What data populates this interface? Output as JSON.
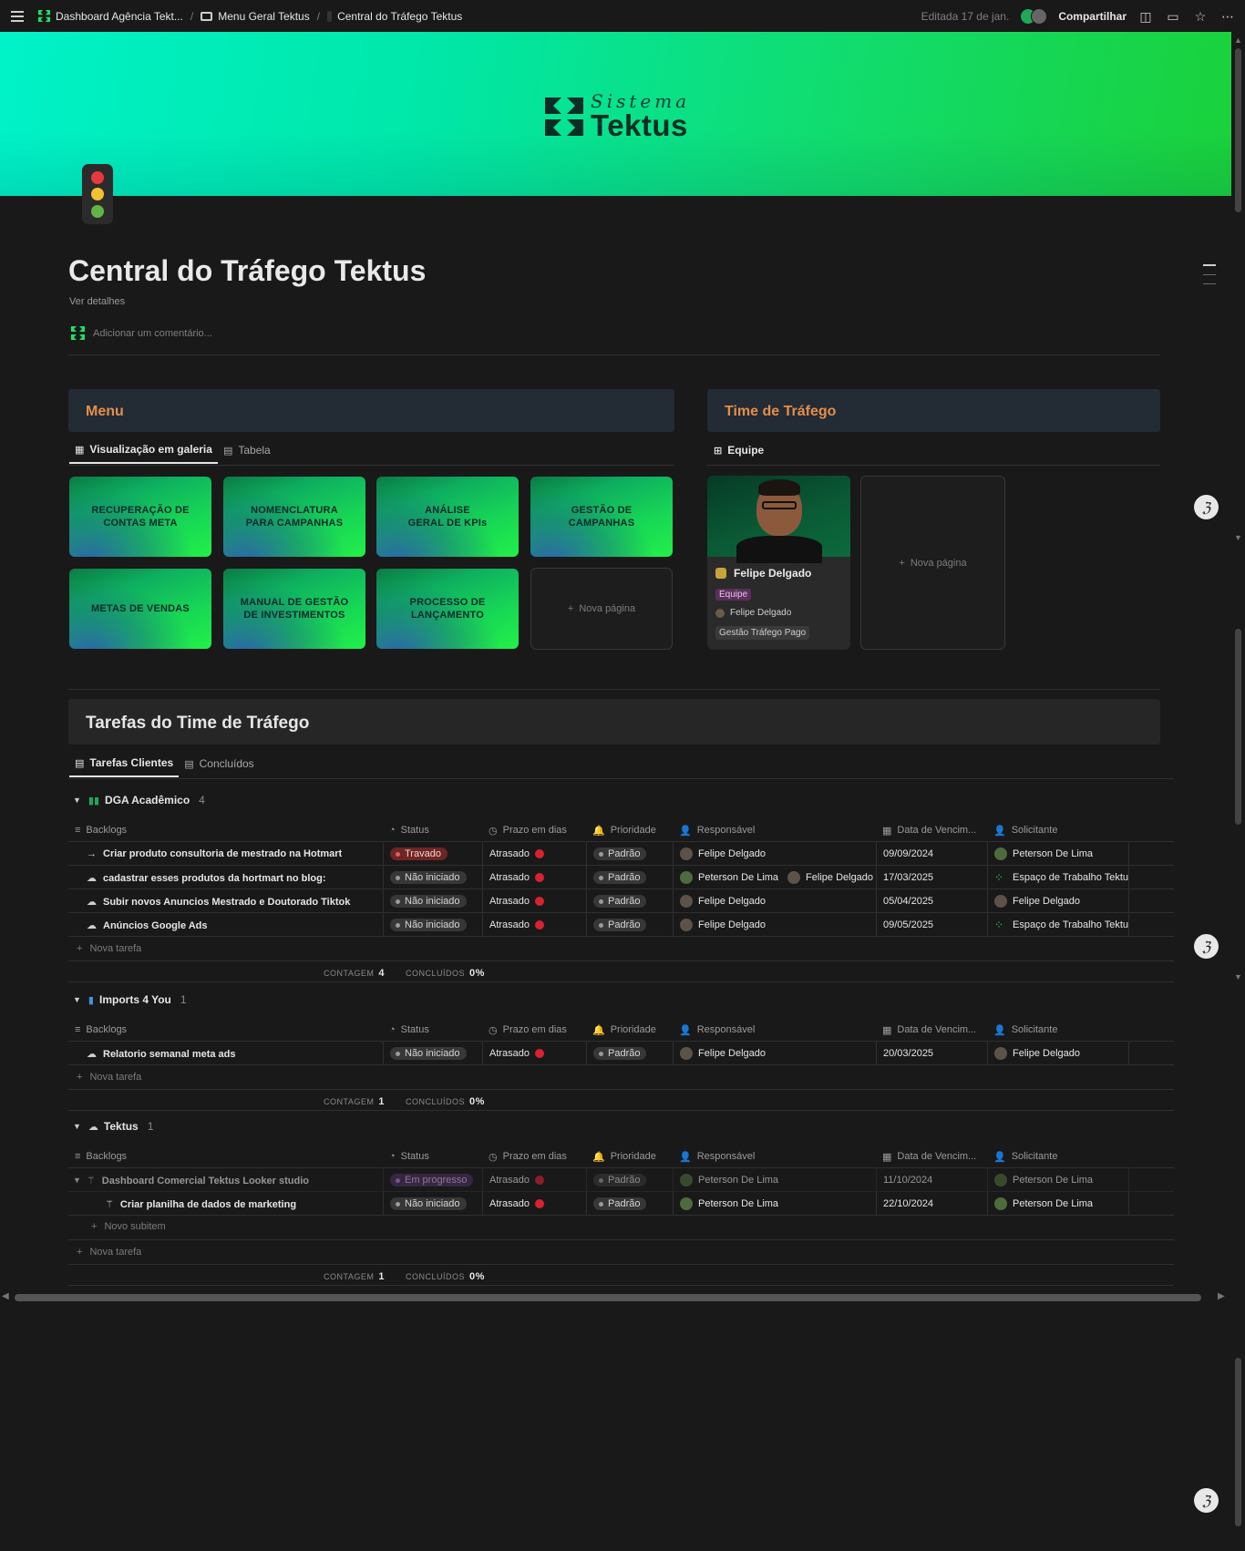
{
  "topbar": {
    "breadcrumbs": [
      "Dashboard Agência Tekt...",
      "Menu Geral Tektus",
      "Central do Tráfego Tektus"
    ],
    "edited": "Editada 17 de jan.",
    "share": "Compartilhar"
  },
  "cover": {
    "logo_top": "Sistema",
    "logo_main": "Tektus"
  },
  "page": {
    "title": "Central do Tráfego Tektus",
    "details": "Ver detalhes",
    "comment_placeholder": "Adicionar um comentário..."
  },
  "menu": {
    "title": "Menu",
    "views": [
      "Visualização em galeria",
      "Tabela"
    ],
    "cards": [
      "RECUPERAÇÃO DE CONTAS META",
      "NOMENCLATURA PARA CAMPANHAS",
      "ANÁLISE GERAL DE KPIs",
      "GESTÃO DE CAMPANHAS",
      "METAS DE VENDAS",
      "MANUAL DE GESTÃO DE INVESTIMENTOS",
      "PROCESSO DE LANÇAMENTO"
    ],
    "new_page": "Nova página"
  },
  "team": {
    "title": "Time de Tráfego",
    "view": "Equipe",
    "member": {
      "name": "Felipe Delgado",
      "tag": "Equipe",
      "person": "Felipe Delgado",
      "area": "Gestão Tráfego Pago"
    },
    "new_page": "Nova página"
  },
  "tasks": {
    "title": "Tarefas do Time de Tráfego",
    "views": [
      "Tarefas Clientes",
      "Concluídos"
    ],
    "columns": [
      "Backlogs",
      "Status",
      "Prazo em dias",
      "Prioridade",
      "Responsável",
      "Data de Vencim...",
      "Solicitante"
    ],
    "new_task": "Nova tarefa",
    "new_subitem": "Novo subitem",
    "count_label": "CONTAGEM",
    "done_label": "CONCLUÍDOS",
    "groups": [
      {
        "name": "DGA Acadêmico",
        "count": "4",
        "footer_count": "4",
        "footer_done": "0%",
        "rows": [
          {
            "name": "Criar produto consultoria de mestrado na Hotmart",
            "status": "Travado",
            "prazo": "Atrasado",
            "prioridade": "Padrão",
            "responsavel": [
              "Felipe Delgado"
            ],
            "data": "09/09/2024",
            "solicitante": "Peterson De Lima"
          },
          {
            "name": "cadastrar esses produtos da hortmart no blog:",
            "status": "Não iniciado",
            "prazo": "Atrasado",
            "prioridade": "Padrão",
            "responsavel": [
              "Peterson De Lima",
              "Felipe Delgado"
            ],
            "data": "17/03/2025",
            "solicitante": "Espaço de Trabalho Tektus"
          },
          {
            "name": "Subir novos Anuncios Mestrado e Doutorado Tiktok",
            "status": "Não iniciado",
            "prazo": "Atrasado",
            "prioridade": "Padrão",
            "responsavel": [
              "Felipe Delgado"
            ],
            "data": "05/04/2025",
            "solicitante": "Felipe Delgado"
          },
          {
            "name": "Anúncios Google Ads",
            "status": "Não iniciado",
            "prazo": "Atrasado",
            "prioridade": "Padrão",
            "responsavel": [
              "Felipe Delgado"
            ],
            "data": "09/05/2025",
            "solicitante": "Espaço de Trabalho Tektus"
          }
        ]
      },
      {
        "name": "Imports 4 You",
        "count": "1",
        "footer_count": "1",
        "footer_done": "0%",
        "rows": [
          {
            "name": "Relatorio semanal meta ads",
            "status": "Não iniciado",
            "prazo": "Atrasado",
            "prioridade": "Padrão",
            "responsavel": [
              "Felipe Delgado"
            ],
            "data": "20/03/2025",
            "solicitante": "Felipe Delgado"
          }
        ]
      },
      {
        "name": "Tektus",
        "count": "1",
        "footer_count": "1",
        "footer_done": "0%",
        "rows": [
          {
            "name": "Dashboard Comercial Tektus Looker studio",
            "status": "Em progresso",
            "prazo": "Atrasado",
            "prioridade": "Padrão",
            "responsavel": [
              "Peterson De Lima"
            ],
            "data": "11/10/2024",
            "solicitante": "Peterson De Lima"
          },
          {
            "name": "Criar planilha de dados de marketing",
            "status": "Não iniciado",
            "prazo": "Atrasado",
            "prioridade": "Padrão",
            "responsavel": [
              "Peterson De Lima"
            ],
            "data": "22/10/2024",
            "solicitante": "Peterson De Lima"
          }
        ]
      }
    ]
  },
  "colors": {
    "accent_orange": "#e58e48",
    "status_red": "#d8222f",
    "brand_green": "#1fe067"
  }
}
